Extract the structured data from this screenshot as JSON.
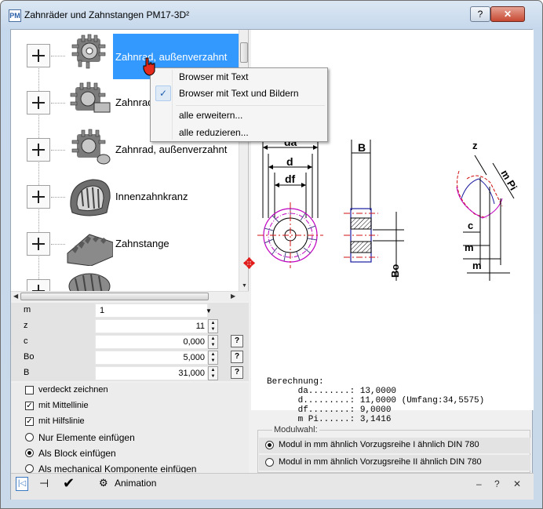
{
  "window": {
    "title": "Zahnräder und Zahnstangen  PM17-3D²",
    "icon_text": "PM",
    "help_btn": "?",
    "close_btn": "✕"
  },
  "tree": {
    "items": [
      {
        "label": "Zahnrad, außenverzahnt"
      },
      {
        "label": "Zahnrad, außenverzahnt"
      },
      {
        "label": "Zahnrad, außenverzahnt"
      },
      {
        "label": "Innenzahnkranz"
      },
      {
        "label": "Zahnstange"
      },
      {
        "label": ""
      }
    ]
  },
  "context_menu": {
    "items": [
      {
        "label": "Browser mit Text",
        "checked": false
      },
      {
        "label": "Browser mit Text und Bildern",
        "checked": true
      },
      {
        "label": "alle erweitern..."
      },
      {
        "label": "alle reduzieren..."
      }
    ]
  },
  "params": [
    {
      "name": "m",
      "value": "1",
      "type": "dropdown"
    },
    {
      "name": "z",
      "value": "11",
      "type": "spin"
    },
    {
      "name": "c",
      "value": "0,000",
      "type": "spin",
      "help": "?"
    },
    {
      "name": "Bo",
      "value": "5,000",
      "type": "spin",
      "help": "?"
    },
    {
      "name": "B",
      "value": "31,000",
      "type": "spin",
      "help": "?"
    }
  ],
  "options": [
    {
      "label": "verdeckt zeichnen",
      "kind": "checkbox",
      "checked": false
    },
    {
      "label": "mit Mittellinie",
      "kind": "checkbox",
      "checked": true
    },
    {
      "label": "mit Hilfslinie",
      "kind": "checkbox",
      "checked": true
    },
    {
      "label": "Nur Elemente einfügen",
      "kind": "radio",
      "checked": false
    },
    {
      "label": "Als Block einfügen",
      "kind": "radio",
      "checked": true
    },
    {
      "label": "Als mechanical Komponente einfügen",
      "kind": "radio",
      "checked": false
    }
  ],
  "drawing_labels": {
    "da": "da",
    "d": "d",
    "df": "df",
    "B": "B",
    "Bo": "Bo",
    "z": "z",
    "m": "m",
    "m_pi": "m Pi",
    "c": "c"
  },
  "calc": "Berechnung:\n      da........: 13,0000\n      d.........: 11,0000 (Umfang:34,5575)\n      df........: 9,0000\n      m Pi......: 3,1416",
  "modulwahl": {
    "legend": "Modulwahl:",
    "options": [
      {
        "label": "Modul in mm ähnlich Vorzugsreihe I ähnlich DIN 780",
        "checked": true
      },
      {
        "label": "Modul in mm ähnlich Vorzugsreihe II ähnlich DIN 780",
        "checked": false
      }
    ]
  },
  "bottom": {
    "animation_label": "Animation",
    "ok_glyph": "✔",
    "pin_glyph": "⊣",
    "collapse_glyph": "|◁",
    "minus": "–",
    "help": "?",
    "close": "✕"
  }
}
